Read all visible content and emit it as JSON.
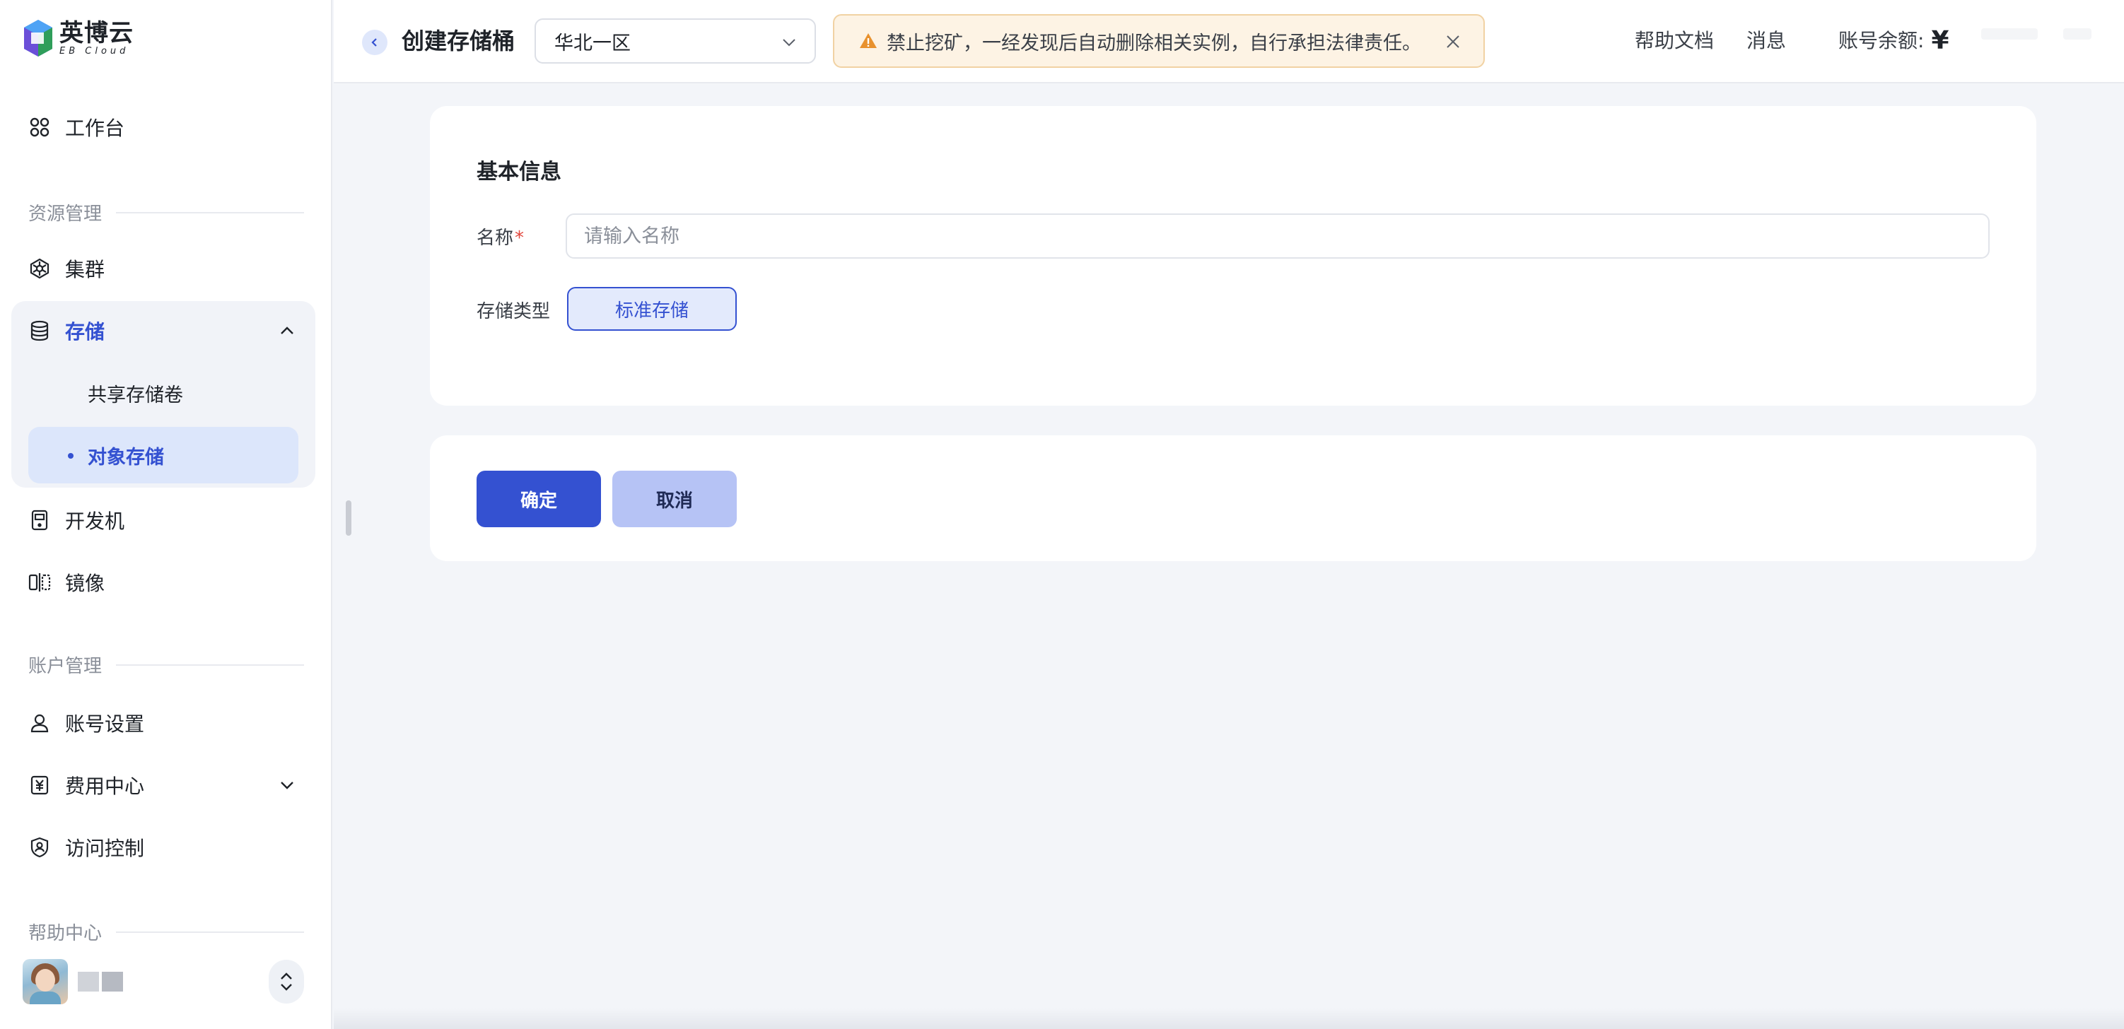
{
  "app": {
    "logo_cn": "英博云",
    "logo_en": "EB Cloud"
  },
  "sidebar": {
    "workspace": "工作台",
    "section_resources": "资源管理",
    "cluster": "集群",
    "storage": "存储",
    "storage_children": {
      "shared_volume": "共享存储卷",
      "object_storage": "对象存储"
    },
    "dev_machine": "开发机",
    "image": "镜像",
    "section_account": "账户管理",
    "account_settings": "账号设置",
    "billing": "费用中心",
    "access_control": "访问控制",
    "section_help": "帮助中心"
  },
  "header": {
    "title": "创建存储桶",
    "region": "华北一区",
    "notice": "禁止挖矿，一经发现后自动删除相关实例，自行承担法律责任。",
    "help_docs": "帮助文档",
    "messages": "消息",
    "balance_label": "账号余额:",
    "balance_symbol": "¥"
  },
  "form": {
    "section_title": "基本信息",
    "name_label": "名称",
    "required_mark": "*",
    "name_placeholder": "请输入名称",
    "name_value": "",
    "storage_type_label": "存储类型",
    "storage_type_selected": "标准存储"
  },
  "actions": {
    "confirm": "确定",
    "cancel": "取消"
  },
  "colors": {
    "accent": "#3451d1",
    "accent_light": "#dce6fb",
    "warning_bg": "#fdf3e4",
    "warning_icon": "#e8912d"
  }
}
